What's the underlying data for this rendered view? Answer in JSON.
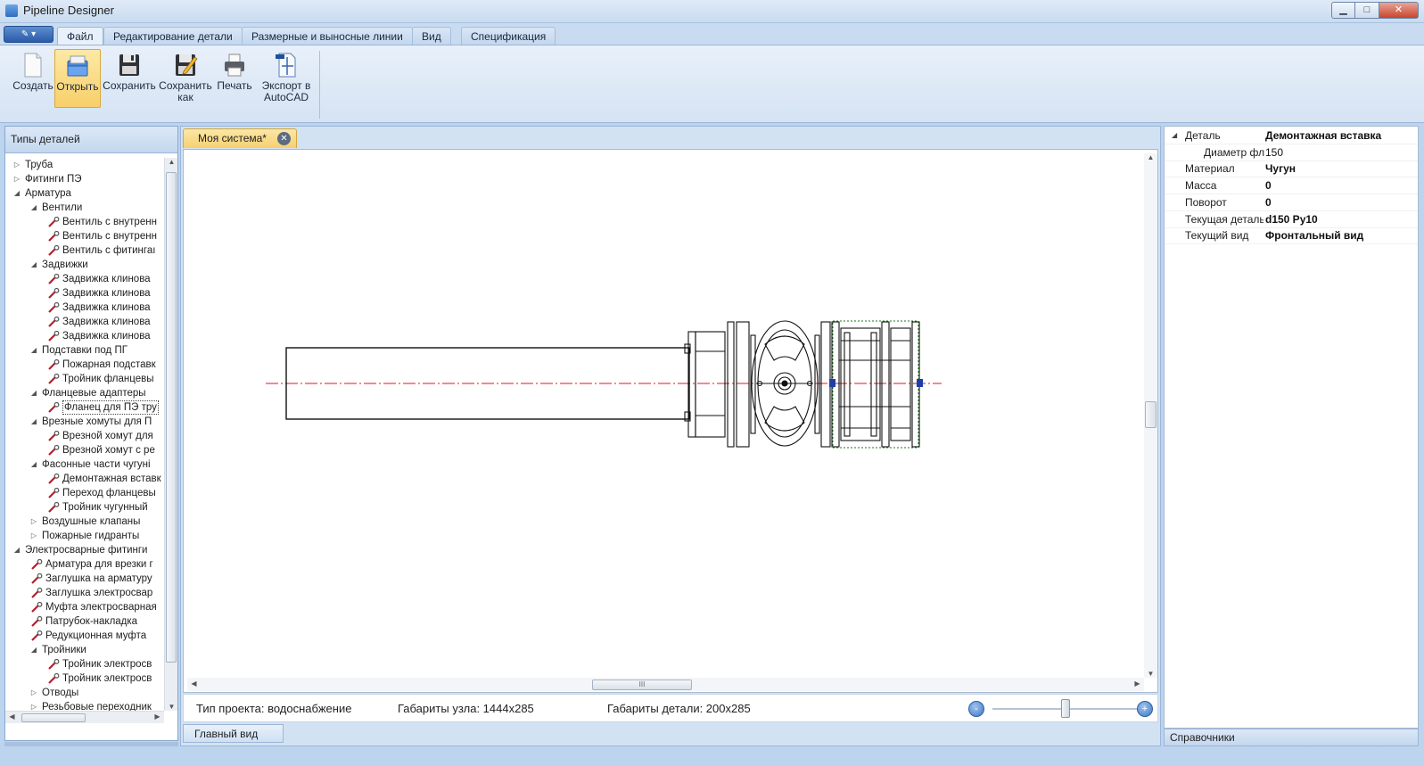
{
  "window": {
    "title": "Pipeline Designer",
    "controls": {
      "minimize": "▁",
      "maximize": "□",
      "close": "✕"
    }
  },
  "ribbon": {
    "app_menu_label": "✎ ▾",
    "tabs": [
      "Файл",
      "Редактирование детали",
      "Размерные и выносные линии",
      "Вид",
      "Спецификация"
    ],
    "active_tab": "Файл",
    "buttons": [
      {
        "label": "Создать",
        "icon": "new-document-icon"
      },
      {
        "label": "Открыть",
        "icon": "open-folder-icon"
      },
      {
        "label": "Сохранить",
        "icon": "floppy-disk-icon"
      },
      {
        "label_line1": "Сохранить",
        "label_line2": "как",
        "icon": "save-as-icon"
      },
      {
        "label": "Печать",
        "icon": "printer-icon"
      },
      {
        "label_line1": "Экспорт в",
        "label_line2": "AutoCAD",
        "icon": "autocad-export-icon"
      }
    ]
  },
  "left_panel": {
    "title": "Типы деталей",
    "tree": [
      {
        "level": 0,
        "type": "collapsed",
        "label": "Труба"
      },
      {
        "level": 0,
        "type": "collapsed",
        "label": "Фитинги ПЭ"
      },
      {
        "level": 0,
        "type": "expanded",
        "label": "Арматура"
      },
      {
        "level": 1,
        "type": "expanded",
        "label": "Вентили"
      },
      {
        "level": 2,
        "type": "leaf",
        "label": "Вентиль с внутренн"
      },
      {
        "level": 2,
        "type": "leaf",
        "label": "Вентиль с внутренн"
      },
      {
        "level": 2,
        "type": "leaf",
        "label": "Вентиль с фитингаı"
      },
      {
        "level": 1,
        "type": "expanded",
        "label": "Задвижки"
      },
      {
        "level": 2,
        "type": "leaf",
        "label": "Задвижка клинова"
      },
      {
        "level": 2,
        "type": "leaf",
        "label": "Задвижка клинова"
      },
      {
        "level": 2,
        "type": "leaf",
        "label": "Задвижка клинова"
      },
      {
        "level": 2,
        "type": "leaf",
        "label": "Задвижка клинова"
      },
      {
        "level": 2,
        "type": "leaf",
        "label": "Задвижка клинова"
      },
      {
        "level": 1,
        "type": "expanded",
        "label": "Подставки под ПГ"
      },
      {
        "level": 2,
        "type": "leaf",
        "label": "Пожарная подставк"
      },
      {
        "level": 2,
        "type": "leaf",
        "label": "Тройник фланцевы"
      },
      {
        "level": 1,
        "type": "expanded",
        "label": "Фланцевые адаптеры"
      },
      {
        "level": 2,
        "type": "leaf",
        "label": "Фланец для ПЭ тру",
        "selected": true
      },
      {
        "level": 1,
        "type": "expanded",
        "label": "Врезные хомуты для П"
      },
      {
        "level": 2,
        "type": "leaf",
        "label": "Врезной хомут для"
      },
      {
        "level": 2,
        "type": "leaf",
        "label": "Врезной хомут с ре"
      },
      {
        "level": 1,
        "type": "expanded",
        "label": "Фасонные части чугуні"
      },
      {
        "level": 2,
        "type": "leaf",
        "label": "Демонтажная вставк"
      },
      {
        "level": 2,
        "type": "leaf",
        "label": "Переход фланцевы"
      },
      {
        "level": 2,
        "type": "leaf",
        "label": "Тройник чугунный"
      },
      {
        "level": 1,
        "type": "collapsed",
        "label": "Воздушные клапаны"
      },
      {
        "level": 1,
        "type": "collapsed",
        "label": "Пожарные гидранты"
      },
      {
        "level": 0,
        "type": "expanded",
        "label": "Электросварные фитинги"
      },
      {
        "level": 1,
        "type": "leaf",
        "label": "Арматура для врезки г"
      },
      {
        "level": 1,
        "type": "leaf",
        "label": "Заглушка на арматуру"
      },
      {
        "level": 1,
        "type": "leaf",
        "label": "Заглушка электросвар"
      },
      {
        "level": 1,
        "type": "leaf",
        "label": "Муфта электросварная"
      },
      {
        "level": 1,
        "type": "leaf",
        "label": "Патрубок-накладка"
      },
      {
        "level": 1,
        "type": "leaf",
        "label": "Редукционная муфта"
      },
      {
        "level": 1,
        "type": "expanded",
        "label": "Тройники"
      },
      {
        "level": 2,
        "type": "leaf",
        "label": "Тройник электросв"
      },
      {
        "level": 2,
        "type": "leaf",
        "label": "Тройник электросв"
      },
      {
        "level": 1,
        "type": "collapsed",
        "label": "Отводы"
      },
      {
        "level": 1,
        "type": "collapsed",
        "label": "Резьбовые переходник"
      }
    ]
  },
  "document": {
    "tab_label": "Моя система*",
    "scroll_grip": "III",
    "status": {
      "project_type": "Тип проекта: водоснабжение",
      "assembly_size": "Габариты узла: 1444x285",
      "part_size": "Габариты детали: 200x285"
    },
    "zoom": {
      "minus": "-",
      "plus": "+",
      "level": 0.5
    },
    "view_tab": "Главный вид",
    "colors": {
      "axis_line": "#e0141e",
      "selection": "#1a7a1a",
      "handle": "#1f3fa8"
    }
  },
  "properties": {
    "rows": [
      {
        "name": "Деталь",
        "value": "Демонтажная вставка",
        "bold": true,
        "group": true
      },
      {
        "name": "Диаметр фл",
        "value": "150",
        "bold": false,
        "indent": true
      },
      {
        "name": "Материал",
        "value": "Чугун",
        "bold": true
      },
      {
        "name": "Масса",
        "value": "0",
        "bold": true
      },
      {
        "name": "Поворот",
        "value": "0",
        "bold": true
      },
      {
        "name": "Текущая деталь",
        "value": "d150 Py10",
        "bold": true
      },
      {
        "name": "Текущий вид",
        "value": "Фронтальный вид",
        "bold": true
      }
    ],
    "footer": "Справочники"
  }
}
